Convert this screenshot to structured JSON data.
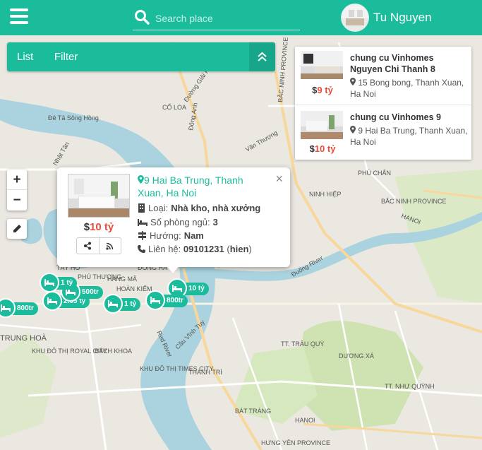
{
  "search": {
    "placeholder": "Search place"
  },
  "user": {
    "name": "Tu Nguyen"
  },
  "listbar": {
    "tabs": [
      "List",
      "Filter"
    ]
  },
  "zoom": {
    "in": "+",
    "out": "−"
  },
  "results": [
    {
      "title": "chung cu Vinhomes Nguyen Chi Thanh 8",
      "address": "15 Bong bong, Thanh Xuan, Ha Noi",
      "price_currency": "$",
      "price_value": "9 tỷ"
    },
    {
      "title": "chung cu Vinhomes 9",
      "address": "9 Hai Ba Trung, Thanh Xuan, Ha Noi",
      "price_currency": "$",
      "price_value": "10 tỷ"
    }
  ],
  "popup": {
    "address": "9 Hai Ba Trung, Thanh Xuan, Ha Noi",
    "price_currency": "$",
    "price_value": "10 tỷ",
    "type_label": "Loại:",
    "type_value": "Nhà kho, nhà xưởng",
    "rooms_label": "Số phòng ngủ:",
    "rooms_value": "3",
    "direction_label": "Hướng:",
    "direction_value": "Nam",
    "contact_label": "Liên hệ:",
    "contact_phone": "09101231",
    "contact_name": "hien",
    "close": "×"
  },
  "markers": [
    "10 tỷ",
    "800tr",
    "1 tỷ",
    "2.05 tỷ",
    "500tr",
    "1 tỷ",
    "800tr"
  ],
  "map_labels": [
    "PHÚ THƯỢNG",
    "TÂY HỒ",
    "CỔ LOA",
    "Đường Giải Phóng",
    "BẮC NINH PROVINCE",
    "Đông Anh",
    "PHÚ CHẤN",
    "BẮC NINH PROVINCE",
    "NINH HIỆP",
    "HANOI",
    "ĐÔNG HÀ",
    "HOÀN KIẾM",
    "HÀNG MÃ",
    "TRUNG HOÀ",
    "KHU ĐÔ THỊ ROYAL CITY",
    "BÁCH KHOA",
    "KHU ĐÔ THỊ TIMES CITY",
    "THANH TRÌ",
    "TT. TRÂU QUỲ",
    "DƯƠNG XÁ",
    "TT. NHƯ QUỲNH",
    "BÁT TRÀNG",
    "HANOI",
    "HƯNG YÊN PROVINCE",
    "Cầu Vĩnh Tuy",
    "Red River",
    "Đuống River",
    "Đê Tả Sông Hồng",
    "Vân Thượng",
    "Nhật Tân"
  ],
  "colors": {
    "accent": "#1abc9c",
    "accent_dark": "#17a689",
    "price": "#e74c3c",
    "river": "#aad3df",
    "green": "#c8dfa8"
  }
}
